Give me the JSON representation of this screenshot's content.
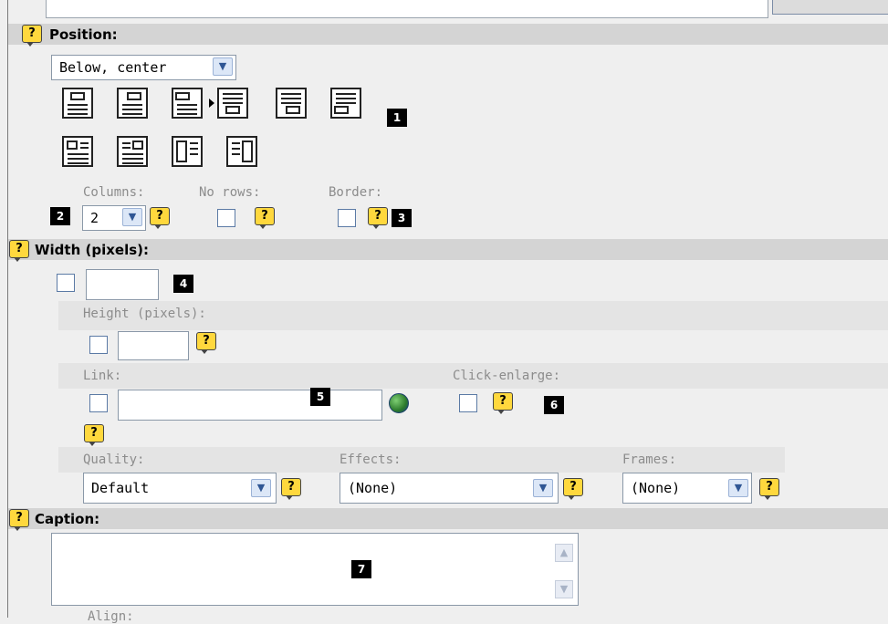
{
  "position": {
    "title": "Position:",
    "select_value": "Below, center",
    "columns_label": "Columns:",
    "columns_value": "2",
    "no_rows_label": "No rows:",
    "border_label": "Border:"
  },
  "width": {
    "title": "Width (pixels):",
    "height_label": "Height (pixels):",
    "link_label": "Link:",
    "click_enlarge_label": "Click-enlarge:",
    "quality_label": "Quality:",
    "quality_value": "Default",
    "effects_label": "Effects:",
    "effects_value": "(None)",
    "frames_label": "Frames:",
    "frames_value": "(None)"
  },
  "caption": {
    "title": "Caption:",
    "align_label": "Align:"
  },
  "help_glyph": "?",
  "dropdown_glyph": "▼",
  "callouts": [
    "1",
    "2",
    "3",
    "4",
    "5",
    "6",
    "7"
  ],
  "icons": [
    "help-icon",
    "dropdown-arrow-icon",
    "link-browser-globe-icon",
    "position-layout-icon"
  ]
}
